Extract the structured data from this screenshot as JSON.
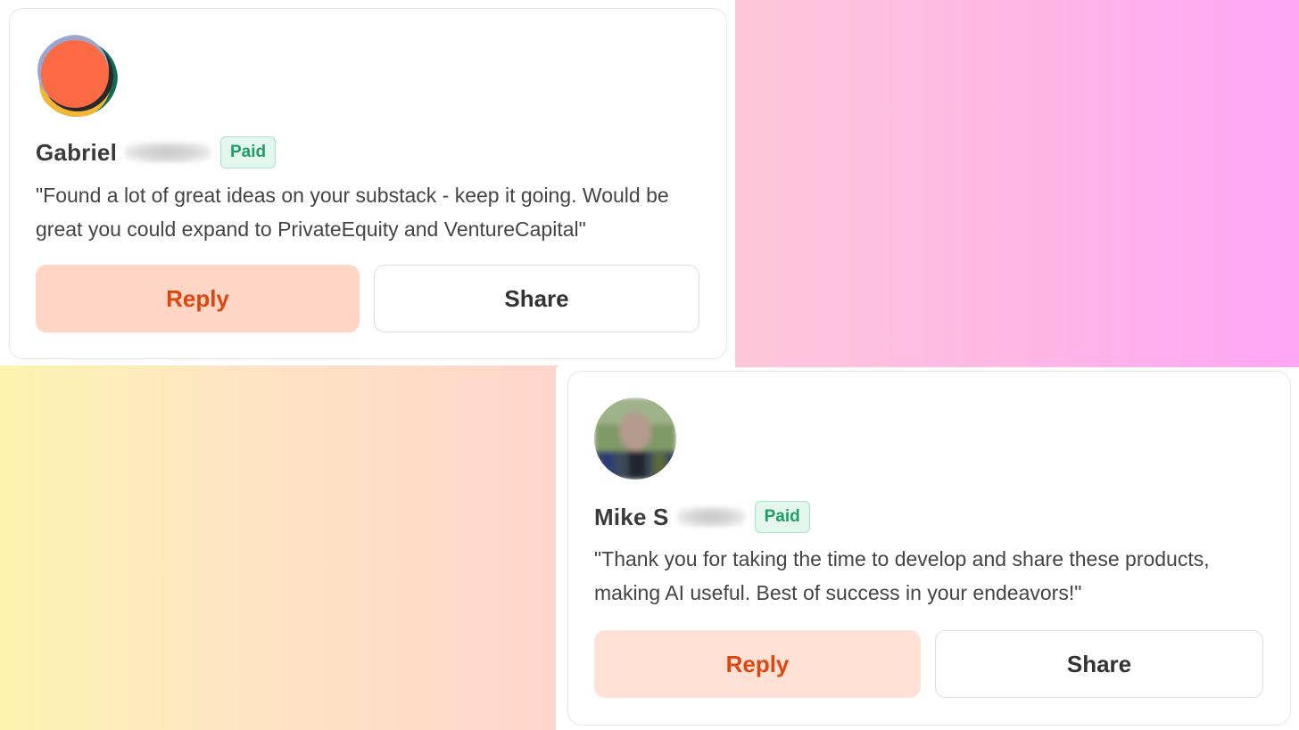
{
  "colors": {
    "accent_reply_bg": "#ffd6c5",
    "accent_reply_text": "#d9480f",
    "paid_badge_text": "#1f9e66",
    "paid_badge_bg": "#e3f7ee"
  },
  "testimonials": [
    {
      "first_name": "Gabriel",
      "surname_redacted": true,
      "badge": "Paid",
      "quote": "\"Found a lot of great ideas on your substack - keep it going. Would be great you could expand to PrivateEquity and VentureCapital\"",
      "reply_label": "Reply",
      "share_label": "Share",
      "avatar_icon": "abstract-orange-circle-avatar"
    },
    {
      "first_name": "Mike S",
      "surname_redacted": true,
      "badge": "Paid",
      "quote": "\"Thank you for taking the time to develop and share these products, making AI useful. Best of success in your endeavors!\"",
      "reply_label": "Reply",
      "share_label": "Share",
      "avatar_icon": "blurred-photo-avatar"
    }
  ]
}
